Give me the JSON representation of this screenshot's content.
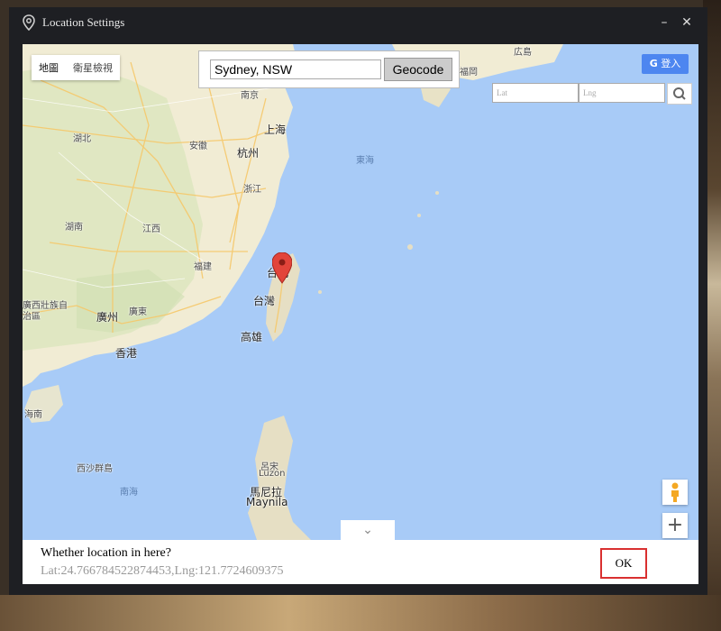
{
  "window": {
    "title": "Location Settings",
    "minimize_glyph": "–",
    "close_glyph": "✕"
  },
  "map": {
    "type_controls": {
      "map_label": "地圖",
      "satellite_label": "衛星檢視"
    },
    "geocode": {
      "input_value": "Sydney, NSW",
      "button_label": "Geocode"
    },
    "login_label": "登入",
    "lat_placeholder": "Lat",
    "lng_placeholder": "Lng",
    "zoom_in_glyph": "+",
    "collapse_glyph": "⌄",
    "labels": {
      "hubei": "湖北",
      "anhui": "安徽",
      "shanghai": "上海",
      "hangzhou": "杭州",
      "zhejiang": "浙江",
      "hunan": "湖南",
      "jiangxi": "江西",
      "fujian": "福建",
      "guangxi": "廣西壯族自治區",
      "guangzhou": "廣州",
      "guangdong": "廣東",
      "hongkong": "香港",
      "hainan": "海南",
      "taipei": "台北",
      "taiwan": "台灣",
      "kaohsiung": "高雄",
      "east_sea": "東海",
      "xisha": "西沙群島",
      "south_sea": "南海",
      "luzon_cn": "呂宋",
      "luzon": "Luzon",
      "manila_cn": "馬尼拉",
      "manila": "Maynila",
      "hiroshima": "広島",
      "fukuoka": "福岡",
      "nanjing": "南京"
    },
    "marker_color": "#e2443a"
  },
  "footer": {
    "question": "Whether location in here?",
    "coords": "Lat:24.766784522874453,Lng:121.7724609375",
    "ok_label": "OK"
  }
}
